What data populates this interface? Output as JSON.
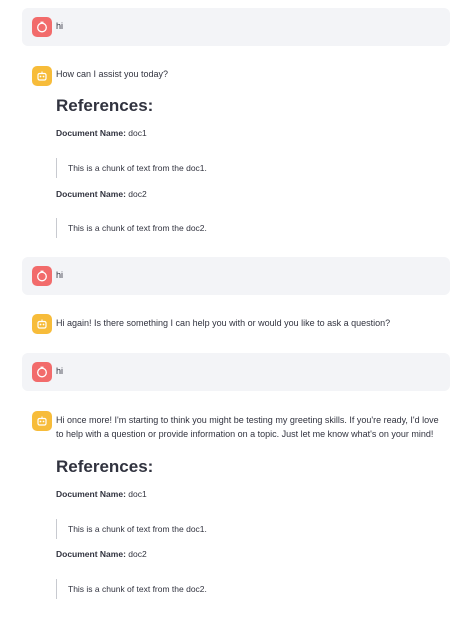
{
  "messages": [
    {
      "role": "user",
      "text": "hi"
    },
    {
      "role": "assistant",
      "text": "How can I assist you today?",
      "references_title": "References:",
      "references": [
        {
          "label": "Document Name:",
          "name": "doc1",
          "chunk": "This is a chunk of text from the doc1."
        },
        {
          "label": "Document Name:",
          "name": "doc2",
          "chunk": "This is a chunk of text from the doc2."
        }
      ]
    },
    {
      "role": "user",
      "text": "hi"
    },
    {
      "role": "assistant",
      "text": "Hi again! Is there something I can help you with or would you like to ask a question?"
    },
    {
      "role": "user",
      "text": "hi"
    },
    {
      "role": "assistant",
      "text_lines": [
        "Hi once more! I'm starting to think you might be testing my greeting skills. If you're ready, I'd love",
        "to help with a question or provide information on a topic. Just let me know what's on your mind!"
      ],
      "references_title": "References:",
      "references": [
        {
          "label": "Document Name:",
          "name": "doc1",
          "chunk": "This is a chunk of text from the doc1."
        },
        {
          "label": "Document Name:",
          "name": "doc2",
          "chunk": "This is a chunk of text from the doc2."
        }
      ]
    }
  ],
  "icons": {
    "user_avatar": "user-avatar-icon",
    "assistant_avatar": "assistant-avatar-icon"
  },
  "colors": {
    "user_avatar_bg": "#f26b6b",
    "assistant_avatar_bg": "#f7bc3a",
    "user_message_bg": "#f3f4f7",
    "text": "#31333f"
  }
}
